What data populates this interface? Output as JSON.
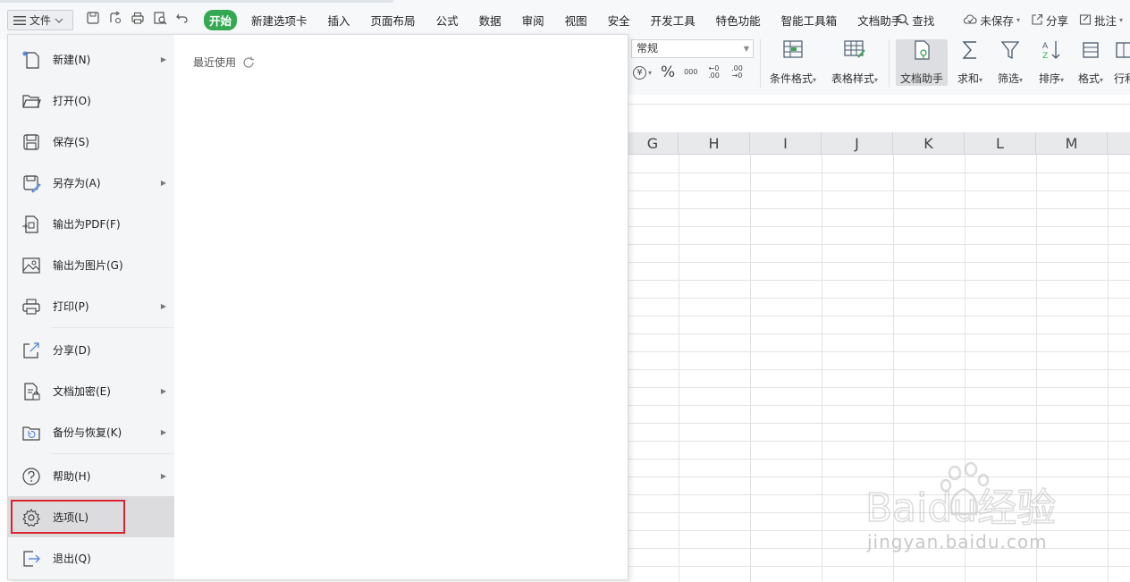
{
  "menubar": {
    "file_label": "文件",
    "tabs": [
      "开始",
      "新建选项卡",
      "插入",
      "页面布局",
      "公式",
      "数据",
      "审阅",
      "视图",
      "安全",
      "开发工具",
      "特色功能",
      "智能工具箱",
      "文档助手"
    ],
    "active_tab": "开始",
    "search_label": "查找",
    "unsaved_label": "未保存",
    "share_label": "分享",
    "comment_label": "批注"
  },
  "ribbon": {
    "number_format": "常规",
    "currency_symbol": "¥",
    "percent_symbol": "%",
    "thousands_symbol": "000",
    "dec_inc_label": "←0 .00",
    "dec_dec_label": ".00 →0",
    "buttons": {
      "conditional_format": "条件格式",
      "table_style": "表格样式",
      "doc_assistant": "文档助手",
      "sum": "求和",
      "filter": "筛选",
      "sort": "排序",
      "format": "格式",
      "rows_cols": "行利"
    }
  },
  "sheet": {
    "columns": [
      "G",
      "H",
      "I",
      "J",
      "K",
      "L",
      "M"
    ]
  },
  "file_menu": {
    "items": [
      {
        "label": "新建(N)",
        "icon": "new-file-icon",
        "submenu": true
      },
      {
        "label": "打开(O)",
        "icon": "folder-open-icon",
        "submenu": false
      },
      {
        "label": "保存(S)",
        "icon": "save-icon",
        "submenu": false
      },
      {
        "label": "另存为(A)",
        "icon": "save-as-icon",
        "submenu": true
      },
      {
        "label": "输出为PDF(F)",
        "icon": "pdf-export-icon",
        "submenu": false
      },
      {
        "label": "输出为图片(G)",
        "icon": "image-export-icon",
        "submenu": false
      },
      {
        "label": "打印(P)",
        "icon": "printer-icon",
        "submenu": true
      },
      {
        "label": "分享(D)",
        "icon": "share-icon",
        "submenu": false
      },
      {
        "label": "文档加密(E)",
        "icon": "encrypt-doc-icon",
        "submenu": true
      },
      {
        "label": "备份与恢复(K)",
        "icon": "backup-icon",
        "submenu": true
      },
      {
        "label": "帮助(H)",
        "icon": "help-icon",
        "submenu": true
      },
      {
        "label": "选项(L)",
        "icon": "gear-icon",
        "submenu": false
      },
      {
        "label": "退出(Q)",
        "icon": "exit-icon",
        "submenu": false
      }
    ],
    "recent_label": "最近使用"
  },
  "watermark": {
    "brand": "Baidu经验",
    "url": "jingyan.baidu.com"
  },
  "colors": {
    "active_tab": "#35a853",
    "highlight_border": "#d9232e"
  }
}
